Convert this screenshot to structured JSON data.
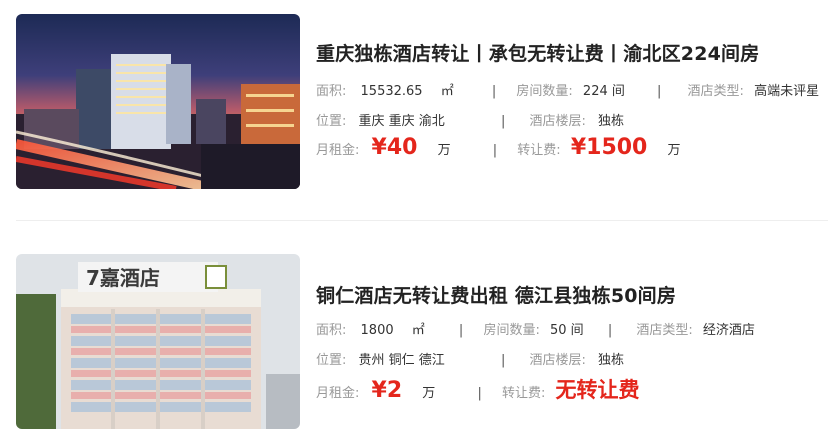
{
  "listings": [
    {
      "title": "重庆独栋酒店转让丨承包无转让费丨渝北区224间房",
      "area_label": "面积:",
      "area_value": "15532.65",
      "area_unit": "㎡",
      "rooms_label": "房间数量:",
      "rooms_value": "224 间",
      "type_label": "酒店类型:",
      "type_value": "高端未评星",
      "location_label": "位置:",
      "location_value": "重庆 重庆 渝北",
      "floor_label": "酒店楼层:",
      "floor_value": "独栋",
      "rent_label": "月租金:",
      "rent_value": "¥40",
      "rent_unit": "万",
      "fee_label": "转让费:",
      "fee_value": "¥1500",
      "fee_unit": "万",
      "image": "night-city-hotel-photo"
    },
    {
      "title": "铜仁酒店无转让费出租 德江县独栋50间房",
      "area_label": "面积:",
      "area_value": "1800",
      "area_unit": "㎡",
      "rooms_label": "房间数量:",
      "rooms_value": "50 间",
      "type_label": "酒店类型:",
      "type_value": "经济酒店",
      "location_label": "位置:",
      "location_value": "贵州 铜仁 德江",
      "floor_label": "酒店楼层:",
      "floor_value": "独栋",
      "rent_label": "月租金:",
      "rent_value": "¥2",
      "rent_unit": "万",
      "fee_label": "转让费:",
      "fee_value": "无转让费",
      "image": "hotel-building-photo",
      "sign_text": "7嘉酒店"
    }
  ],
  "separator": "|",
  "colors": {
    "price": "#e4261c",
    "label": "#999999",
    "value": "#333333"
  }
}
